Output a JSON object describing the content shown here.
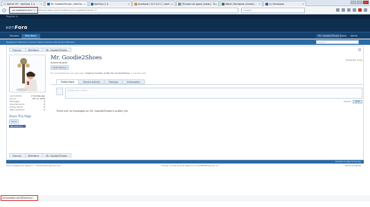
{
  "browser": {
    "tabs": [
      {
        "label": "Admin CP - XenForo 1.4",
        "color": "#d1d6dc"
      },
      {
        "label": "Mr. Goodie2Shoes | XenFor…",
        "color": "#2c6aa3"
      },
      {
        "label": "XenForo 1.4",
        "color": "#2c6aa3"
      },
      {
        "label": "localhost / 127.0.0.1 / xenf…",
        "color": "#e08a2e"
      },
      {
        "label": "[Thread not good_reads] - Ti…",
        "color": "#7a8a99"
      },
      {
        "label": "Watch Hardware (Anime…",
        "color": "#3b7a3b"
      },
      {
        "label": "(1) Facebook",
        "color": "#3b5998"
      }
    ],
    "url_domain": "yourwebsite.dev",
    "url_rest": "/@xenforo/index.php?members/mr-goodie2shoes.1/",
    "search_placeholder": "Google"
  },
  "header": {
    "top_link": "Register In",
    "logo_prefix": "xen",
    "logo_main": "Foro",
    "tabs": [
      {
        "label": "Forums"
      },
      {
        "label": "Members"
      }
    ],
    "user_nav": [
      {
        "label": "Mr. Goodie2Shoes"
      },
      {
        "label": "Inbox"
      },
      {
        "label": "Alerts"
      }
    ],
    "quick_search_placeholder": "Search…",
    "sub_links": "Registered Members   Current Visitors   Recent Activity   Find Member"
  },
  "breadcrumb": [
    {
      "label": "Forums"
    },
    {
      "label": "Members"
    },
    {
      "label": "Mr. Goodie2Shoes"
    }
  ],
  "profile": {
    "info": [
      {
        "label": "Last Activity:",
        "value": "2 minutes ago"
      },
      {
        "label": "Joined:",
        "value": "Oct 11, 2014"
      },
      {
        "label": "Messages:",
        "value": "0"
      },
      {
        "label": "Likes Received:",
        "value": "0"
      },
      {
        "label": "Trophy Points:",
        "value": "0"
      },
      {
        "label": "Warning Points:",
        "value": "0"
      }
    ],
    "share_title": "Share This Page",
    "tweet_label": "Tweet",
    "recommend_label": "Recommend"
  },
  "main": {
    "username": "Mr. Goodie2Shoes",
    "user_title": "Administrator",
    "badge": "Staff Member",
    "visiting_text": "Mr. Goodie2Shoes was last seen: ",
    "visiting_link": "Viewing member profile Mr. Goodie2Shoes",
    "visiting_time": ", 2 minutes ago",
    "followers_text": "Moderator Tools",
    "tabs": [
      {
        "label": "Profile Posts"
      },
      {
        "label": "Recent Activity"
      },
      {
        "label": "Postings"
      },
      {
        "label": "Information"
      }
    ],
    "post_placeholder": "Update your status…",
    "cancel_label": "Cancel",
    "post_button": "Post",
    "no_messages": "There are no messages on Mr. Goodie2Shoes's profile yet."
  },
  "footer": {
    "links": "Contact Us   Help   Home   Top",
    "copyright": "Forum software by XenForo™ ©2010-2014 XenForo Ltd.",
    "timing": "Timing: 0.1749 seconds   Memory: 4.779 MB   DB Queries: 17",
    "terms": "Terms and Rules"
  },
  "status_bar": {
    "text": "yourwebsite.dev/@xenforo/…"
  }
}
